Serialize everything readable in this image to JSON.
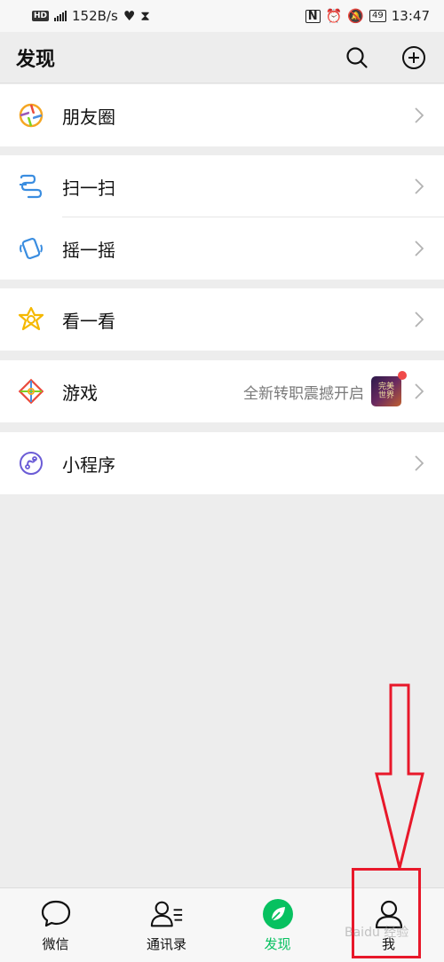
{
  "status_bar": {
    "network": "152B/s",
    "battery": "49",
    "time": "13:47"
  },
  "header": {
    "title": "发现"
  },
  "menu": {
    "moments": "朋友圈",
    "scan": "扫一扫",
    "shake": "摇一摇",
    "top_stories": "看一看",
    "games": "游戏",
    "games_subtitle": "全新转职震撼开启",
    "game_thumb_text": "完美世界",
    "mini_programs": "小程序"
  },
  "tabs": [
    {
      "label": "微信"
    },
    {
      "label": "通讯录"
    },
    {
      "label": "发现"
    },
    {
      "label": "我"
    }
  ],
  "watermark": "Baidu 经验",
  "colors": {
    "accent": "#07c160",
    "annotation": "#e8182a",
    "background": "#ededed"
  }
}
